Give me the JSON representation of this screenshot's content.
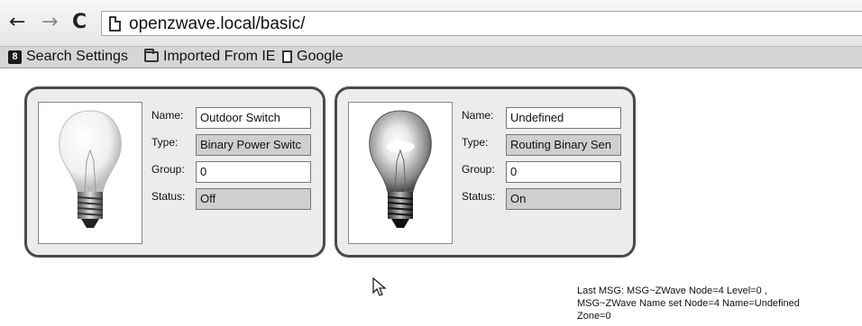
{
  "browser": {
    "back_icon": "←",
    "forward_icon": "→",
    "reload_icon": "C",
    "url": "openzwave.local/basic/"
  },
  "bookmarks": [
    {
      "icon": "8",
      "label": "Search Settings"
    },
    {
      "icon": "folder-icon",
      "label": "Imported From IE"
    },
    {
      "icon": "page-icon",
      "label": "Google"
    }
  ],
  "labels": {
    "name": "Name:",
    "type": "Type:",
    "group": "Group:",
    "status": "Status:"
  },
  "devices": [
    {
      "name": "Outdoor Switch",
      "type": "Binary Power Switc",
      "group": "0",
      "status": "Off",
      "bulb_lit": false
    },
    {
      "name": "Undefined",
      "type": "Routing Binary Sen",
      "group": "0",
      "status": "On",
      "bulb_lit": true
    }
  ],
  "message": {
    "line1": "Last MSG: MSG~ZWave Node=4 Level=0 ,",
    "line2": "MSG~ZWave Name set Node=4 Name=Undefined",
    "line3": "Zone=0"
  }
}
